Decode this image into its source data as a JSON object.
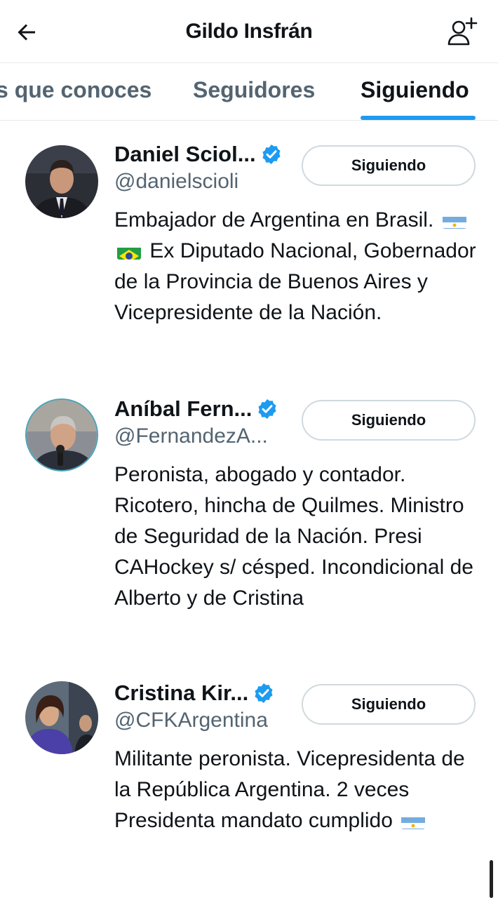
{
  "header": {
    "title": "Gildo Insfrán",
    "back_icon": "arrow-left-icon",
    "add_icon": "add-user-icon"
  },
  "tabs": [
    {
      "label": "s que conoces"
    },
    {
      "label": "Seguidores"
    },
    {
      "label": "Siguiendo"
    }
  ],
  "accent_color": "#1d9bf0",
  "users": [
    {
      "name": "Daniel Sciol...",
      "handle": "@danielscioli",
      "button": "Siguiendo",
      "bio_1": "Embajador de Argentina en Brasil.",
      "bio_2": "Ex Diputado Nacional, Gobernador de la Provincia de Buenos Aires y Vicepresidente de la Nación."
    },
    {
      "name": "Aníbal Fern...",
      "handle": "@FernandezA...",
      "button": "Siguiendo",
      "bio": "Peronista, abogado y contador. Ricotero, hincha de Quilmes. Ministro de Seguridad de la Nación. Presi CAHockey s/ césped. Incondicional de Alberto y de Cristina"
    },
    {
      "name": "Cristina Kir...",
      "handle": "@CFKArgentina",
      "button": "Siguiendo",
      "bio": "Militante peronista. Vicepresidenta de la República Argentina. 2 veces Presidenta mandato cumplido"
    }
  ]
}
